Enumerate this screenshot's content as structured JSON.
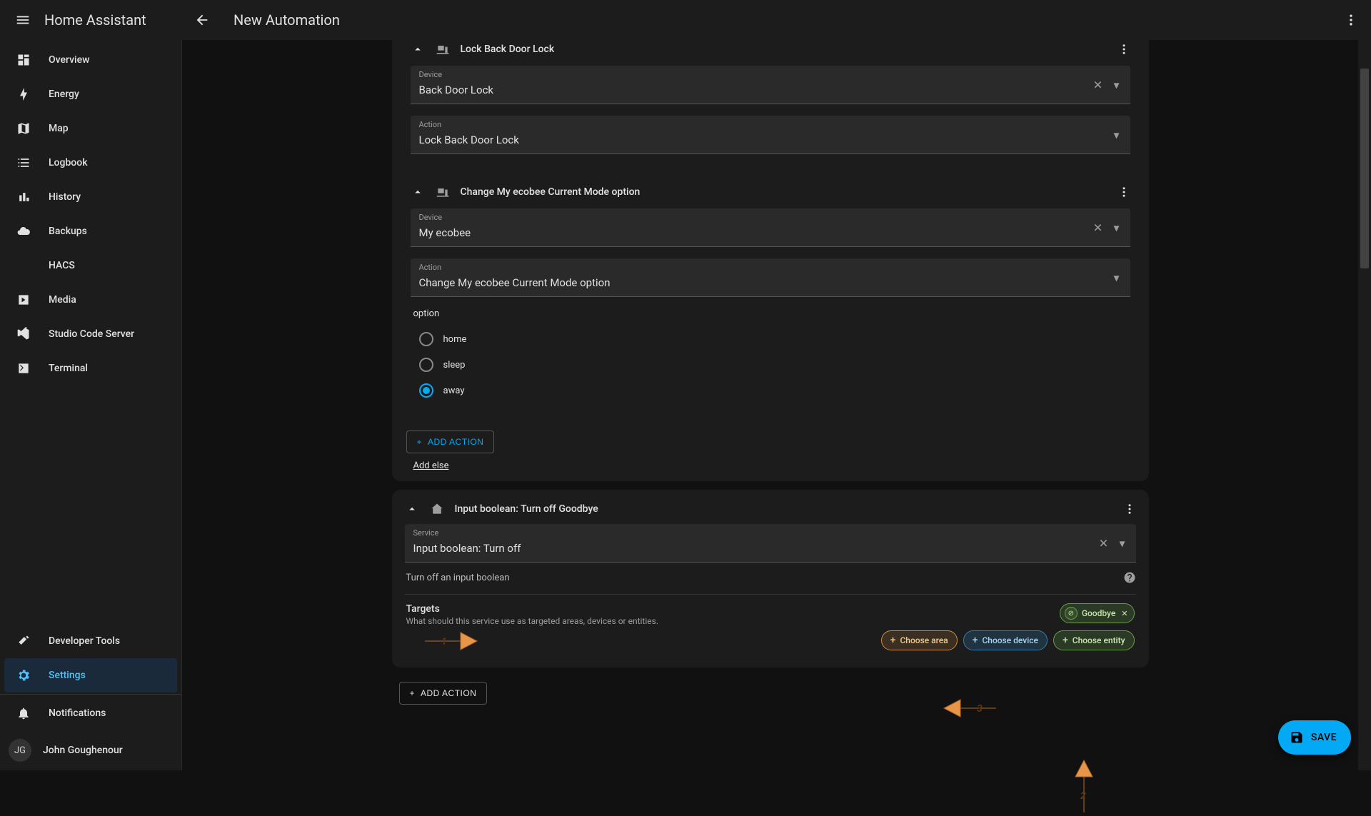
{
  "app_title": "Home Assistant",
  "page_title": "New Automation",
  "sidebar": {
    "items": [
      {
        "label": "Overview"
      },
      {
        "label": "Energy"
      },
      {
        "label": "Map"
      },
      {
        "label": "Logbook"
      },
      {
        "label": "History"
      },
      {
        "label": "Backups"
      },
      {
        "label": "HACS"
      },
      {
        "label": "Media"
      },
      {
        "label": "Studio Code Server"
      },
      {
        "label": "Terminal"
      }
    ],
    "bottom": {
      "dev_tools": "Developer Tools",
      "settings": "Settings",
      "notifications": "Notifications"
    },
    "user": {
      "initials": "JG",
      "name": "John Goughenour"
    }
  },
  "actions": {
    "0": {
      "title": "Lock Back Door Lock",
      "device_label": "Device",
      "device_value": "Back Door Lock",
      "action_label": "Action",
      "action_value": "Lock Back Door Lock"
    },
    "1": {
      "title": "Change My ecobee Current Mode option",
      "device_label": "Device",
      "device_value": "My ecobee",
      "action_label": "Action",
      "action_value": "Change My ecobee Current Mode option",
      "option_label": "option",
      "options": {
        "0": "home",
        "1": "sleep",
        "2": "away"
      },
      "selected": "away"
    },
    "2": {
      "title": "Input boolean: Turn off Goodbye",
      "service_label": "Service",
      "service_value": "Input boolean: Turn off",
      "description": "Turn off an input boolean",
      "targets_title": "Targets",
      "targets_sub": "What should this service use as targeted areas, devices or entities.",
      "tag": "Goodbye",
      "choose_area": "Choose area",
      "choose_device": "Choose device",
      "choose_entity": "Choose entity"
    }
  },
  "buttons": {
    "add_action": "ADD ACTION",
    "add_else": "Add else",
    "save": "SAVE"
  },
  "annotations": {
    "1": "1",
    "2": "2",
    "3": "3"
  }
}
